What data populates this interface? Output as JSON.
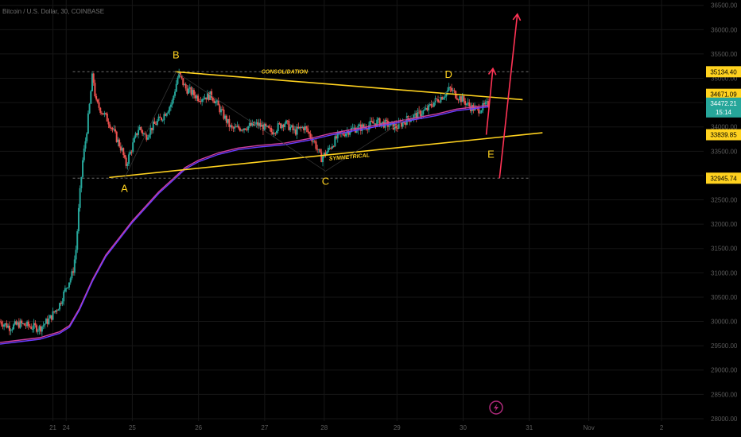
{
  "chart_data": {
    "type": "line",
    "title": "Bitcoin / U.S. Dollar, 30, COINBASE",
    "y_ticks": [
      28000,
      28500,
      29000,
      29500,
      30000,
      30500,
      31000,
      31500,
      32000,
      32500,
      33000,
      33500,
      34000,
      34500,
      35000,
      35500,
      36000,
      36500
    ],
    "y_tick_labels": [
      "28000.00",
      "28500.00",
      "29000.00",
      "29500.00",
      "30000.00",
      "30500.00",
      "31000.00",
      "31500.00",
      "32000.00",
      "32500.00",
      "33000.00",
      "33500.00",
      "34000.00",
      "34500.00",
      "35000.00",
      "35500.00",
      "36000.00",
      "36500.00"
    ],
    "ylim": [
      27950,
      36610
    ],
    "x_ticks": [
      "21",
      "24",
      "25",
      "26",
      "27",
      "28",
      "29",
      "30",
      "31",
      "Nov",
      "2"
    ],
    "x_tick_pos": [
      23.8,
      24.0,
      25.0,
      26.0,
      27.0,
      27.9,
      29.0,
      30.0,
      31.0,
      31.9,
      33.0
    ],
    "xlim": [
      23.0,
      34.2
    ],
    "price_labels": [
      {
        "value": 35134.4,
        "text": "35134.40",
        "color": "#ffd21f",
        "text_color": "#000000"
      },
      {
        "value": 34671.09,
        "text": "34671.09",
        "color": "#ffd21f",
        "text_color": "#000000"
      },
      {
        "value": 33839.85,
        "text": "33839.85",
        "color": "#ffd21f",
        "text_color": "#000000"
      },
      {
        "value": 32945.74,
        "text": "32945.74",
        "color": "#ffd21f",
        "text_color": "#000000"
      }
    ],
    "current_price": {
      "value": 34472.21,
      "text": "34472.21",
      "countdown": "15:14",
      "color": "#26a69a"
    },
    "dashed_levels": [
      35134.4,
      32945.74
    ],
    "price_path": [
      [
        23.0,
        30000
      ],
      [
        23.15,
        29880
      ],
      [
        23.3,
        29950
      ],
      [
        23.45,
        29900
      ],
      [
        23.6,
        29860
      ],
      [
        23.75,
        30050
      ],
      [
        23.9,
        30350
      ],
      [
        24.0,
        30700
      ],
      [
        24.1,
        31000
      ],
      [
        24.15,
        31500
      ],
      [
        24.2,
        32500
      ],
      [
        24.25,
        33300
      ],
      [
        24.3,
        33800
      ],
      [
        24.35,
        34400
      ],
      [
        24.4,
        35100
      ],
      [
        24.45,
        34500
      ],
      [
        24.55,
        34300
      ],
      [
        24.65,
        34100
      ],
      [
        24.75,
        33800
      ],
      [
        24.85,
        33500
      ],
      [
        24.9,
        33200
      ],
      [
        25.0,
        33600
      ],
      [
        25.1,
        34000
      ],
      [
        25.2,
        33800
      ],
      [
        25.3,
        34000
      ],
      [
        25.45,
        34200
      ],
      [
        25.6,
        34500
      ],
      [
        25.7,
        35100
      ],
      [
        25.8,
        34800
      ],
      [
        26.0,
        34600
      ],
      [
        26.2,
        34650
      ],
      [
        26.35,
        34300
      ],
      [
        26.5,
        33950
      ],
      [
        26.7,
        34000
      ],
      [
        26.9,
        34050
      ],
      [
        27.1,
        33900
      ],
      [
        27.3,
        34100
      ],
      [
        27.45,
        33900
      ],
      [
        27.6,
        34000
      ],
      [
        27.75,
        33700
      ],
      [
        27.85,
        33350
      ],
      [
        27.95,
        33500
      ],
      [
        28.1,
        33800
      ],
      [
        28.3,
        33950
      ],
      [
        28.5,
        34000
      ],
      [
        28.7,
        34100
      ],
      [
        28.85,
        34050
      ],
      [
        29.0,
        34000
      ],
      [
        29.15,
        34150
      ],
      [
        29.3,
        34250
      ],
      [
        29.45,
        34350
      ],
      [
        29.55,
        34500
      ],
      [
        29.7,
        34650
      ],
      [
        29.8,
        34780
      ],
      [
        29.9,
        34650
      ],
      [
        30.0,
        34550
      ],
      [
        30.1,
        34420
      ],
      [
        30.2,
        34350
      ],
      [
        30.3,
        34400
      ],
      [
        30.38,
        34472
      ]
    ],
    "ema_path": [
      [
        23.0,
        29550
      ],
      [
        23.3,
        29600
      ],
      [
        23.6,
        29650
      ],
      [
        23.9,
        29770
      ],
      [
        24.05,
        29900
      ],
      [
        24.2,
        30250
      ],
      [
        24.4,
        30850
      ],
      [
        24.6,
        31350
      ],
      [
        24.8,
        31700
      ],
      [
        25.0,
        32050
      ],
      [
        25.2,
        32350
      ],
      [
        25.4,
        32650
      ],
      [
        25.6,
        32900
      ],
      [
        25.8,
        33150
      ],
      [
        26.0,
        33300
      ],
      [
        26.3,
        33450
      ],
      [
        26.6,
        33550
      ],
      [
        26.9,
        33600
      ],
      [
        27.3,
        33650
      ],
      [
        27.7,
        33750
      ],
      [
        28.0,
        33850
      ],
      [
        28.4,
        33950
      ],
      [
        28.8,
        34050
      ],
      [
        29.2,
        34150
      ],
      [
        29.6,
        34250
      ],
      [
        29.9,
        34350
      ],
      [
        30.2,
        34400
      ],
      [
        30.38,
        34430
      ]
    ],
    "points": [
      {
        "label": "A",
        "x": 24.88,
        "y": 32660
      },
      {
        "label": "B",
        "x": 25.66,
        "y": 35410
      },
      {
        "label": "C",
        "x": 27.92,
        "y": 32810
      },
      {
        "label": "D",
        "x": 29.78,
        "y": 35010
      },
      {
        "label": "E",
        "x": 30.42,
        "y": 33370
      }
    ],
    "annotations": [
      {
        "text": "CONSOLIDATION",
        "x": 27.3,
        "y": 35134
      },
      {
        "text": "SYMMETRICAL",
        "x": 28.28,
        "y": 33380
      }
    ],
    "trendlines": [
      {
        "name": "upper",
        "color": "#ffd21f",
        "points": [
          [
            25.65,
            35134
          ],
          [
            30.9,
            34560
          ]
        ]
      },
      {
        "name": "lower",
        "color": "#ffd21f",
        "points": [
          [
            24.65,
            32960
          ],
          [
            31.2,
            33880
          ]
        ]
      }
    ],
    "arrows": [
      {
        "color": "#ff3355",
        "from": [
          30.35,
          33840
        ],
        "to": [
          30.45,
          35200
        ]
      },
      {
        "color": "#ff3355",
        "from": [
          30.55,
          32945
        ],
        "to": [
          30.82,
          36320
        ]
      }
    ],
    "colors": {
      "bull": "#26a69a",
      "bear": "#ef5350",
      "ema_a": "#6a3cff",
      "ema_b": "#d040a0",
      "grid": "#161616",
      "dashed": "#6e6e6e"
    }
  },
  "icons": {
    "lightning": "lightning-icon"
  }
}
